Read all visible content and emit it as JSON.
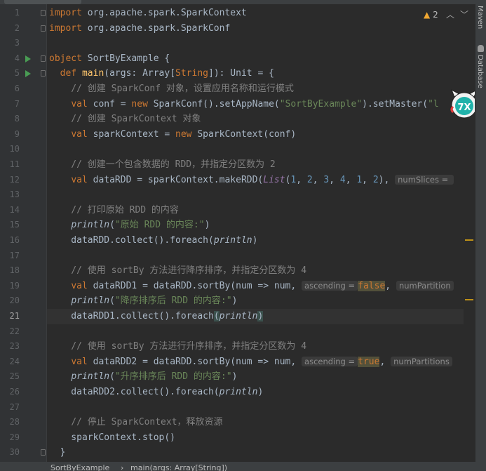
{
  "editor": {
    "warning_count": "2",
    "lines": [
      {
        "n": "1",
        "tokens": [
          [
            "kw",
            "import "
          ],
          [
            "",
            "org.apache.spark.SparkContext"
          ]
        ]
      },
      {
        "n": "2",
        "tokens": [
          [
            "kw",
            "import "
          ],
          [
            "",
            "org.apache.spark.SparkConf"
          ]
        ]
      },
      {
        "n": "3",
        "tokens": []
      },
      {
        "n": "4",
        "tokens": [
          [
            "kw",
            "object "
          ],
          [
            "",
            "SortByExample {"
          ]
        ]
      },
      {
        "n": "5",
        "tokens": [
          [
            "",
            "  "
          ],
          [
            "kw",
            "def "
          ],
          [
            "fn",
            "main"
          ],
          [
            "",
            "(args: Array["
          ],
          [
            "kw",
            "String"
          ],
          [
            "",
            "]): Unit = {"
          ]
        ]
      },
      {
        "n": "6",
        "tokens": [
          [
            "cm",
            "    // 创建 SparkConf 对象，设置应用名称和运行模式"
          ]
        ]
      },
      {
        "n": "7",
        "tokens": [
          [
            "",
            "    "
          ],
          [
            "kw",
            "val "
          ],
          [
            "",
            "conf = "
          ],
          [
            "kw",
            "new "
          ],
          [
            "",
            "SparkConf().setAppName("
          ],
          [
            "str",
            "\"SortByExample\""
          ],
          [
            "",
            ").setMaster("
          ],
          [
            "str",
            "\"l"
          ]
        ]
      },
      {
        "n": "8",
        "tokens": [
          [
            "cm",
            "    // 创建 SparkContext 对象"
          ]
        ]
      },
      {
        "n": "9",
        "tokens": [
          [
            "",
            "    "
          ],
          [
            "kw",
            "val "
          ],
          [
            "",
            "sparkContext = "
          ],
          [
            "kw",
            "new "
          ],
          [
            "",
            "SparkContext(conf)"
          ]
        ]
      },
      {
        "n": "10",
        "tokens": []
      },
      {
        "n": "11",
        "tokens": [
          [
            "cm",
            "    // 创建一个包含数据的 RDD，并指定分区数为 2"
          ]
        ]
      },
      {
        "n": "12",
        "tokens": [
          [
            "",
            "    "
          ],
          [
            "kw",
            "val "
          ],
          [
            "",
            "dataRDD = sparkContext.makeRDD("
          ],
          [
            "pur",
            "List"
          ],
          [
            "",
            "("
          ],
          [
            "num",
            "1"
          ],
          [
            "",
            ", "
          ],
          [
            "num",
            "2"
          ],
          [
            "",
            ", "
          ],
          [
            "num",
            "3"
          ],
          [
            "",
            ", "
          ],
          [
            "num",
            "4"
          ],
          [
            "",
            ", "
          ],
          [
            "num",
            "1"
          ],
          [
            "",
            ", "
          ],
          [
            "num",
            "2"
          ],
          [
            "",
            "), "
          ],
          [
            "hint",
            "numSlices = "
          ]
        ]
      },
      {
        "n": "13",
        "tokens": []
      },
      {
        "n": "14",
        "tokens": [
          [
            "cm",
            "    // 打印原始 RDD 的内容"
          ]
        ]
      },
      {
        "n": "15",
        "tokens": [
          [
            "",
            "    "
          ],
          [
            "it",
            "println"
          ],
          [
            "",
            "("
          ],
          [
            "str",
            "\"原始 RDD 的内容:\""
          ],
          [
            "",
            ")"
          ]
        ]
      },
      {
        "n": "16",
        "tokens": [
          [
            "",
            "    dataRDD.collect().foreach("
          ],
          [
            "it",
            "println"
          ],
          [
            "",
            ")"
          ]
        ]
      },
      {
        "n": "17",
        "tokens": []
      },
      {
        "n": "18",
        "tokens": [
          [
            "cm",
            "    // 使用 sortBy 方法进行降序排序，并指定分区数为 4"
          ]
        ]
      },
      {
        "n": "19",
        "tokens": [
          [
            "",
            "    "
          ],
          [
            "kw",
            "val "
          ],
          [
            "",
            "dataRDD1 = dataRDD.sortBy(num => num, "
          ],
          [
            "hint",
            "ascending ="
          ],
          [
            "",
            ""
          ],
          [
            "hlkw",
            "false"
          ],
          [
            "",
            ", "
          ],
          [
            "hint",
            "numPartition"
          ]
        ]
      },
      {
        "n": "20",
        "tokens": [
          [
            "",
            "    "
          ],
          [
            "it",
            "println"
          ],
          [
            "",
            "("
          ],
          [
            "str",
            "\"降序排序后 RDD 的内容:\""
          ],
          [
            "",
            ")"
          ]
        ]
      },
      {
        "n": "21",
        "tokens": [
          [
            "",
            "    dataRDD1.collect().foreach"
          ],
          [
            "brace",
            "("
          ],
          [
            "it",
            "println"
          ],
          [
            "brace",
            ")"
          ]
        ]
      },
      {
        "n": "22",
        "tokens": []
      },
      {
        "n": "23",
        "tokens": [
          [
            "cm",
            "    // 使用 sortBy 方法进行升序排序，并指定分区数为 4"
          ]
        ]
      },
      {
        "n": "24",
        "tokens": [
          [
            "",
            "    "
          ],
          [
            "kw",
            "val "
          ],
          [
            "",
            "dataRDD2 = dataRDD.sortBy(num => num, "
          ],
          [
            "hint",
            "ascending ="
          ],
          [
            "",
            ""
          ],
          [
            "hlkw",
            "true"
          ],
          [
            "",
            ", "
          ],
          [
            "hint",
            "numPartitions"
          ]
        ]
      },
      {
        "n": "25",
        "tokens": [
          [
            "",
            "    "
          ],
          [
            "it",
            "println"
          ],
          [
            "",
            "("
          ],
          [
            "str",
            "\"升序排序后 RDD 的内容:\""
          ],
          [
            "",
            ")"
          ]
        ]
      },
      {
        "n": "26",
        "tokens": [
          [
            "",
            "    dataRDD2.collect().foreach("
          ],
          [
            "it",
            "println"
          ],
          [
            "",
            ")"
          ]
        ]
      },
      {
        "n": "27",
        "tokens": []
      },
      {
        "n": "28",
        "tokens": [
          [
            "cm",
            "    // 停止 SparkContext，释放资源"
          ]
        ]
      },
      {
        "n": "29",
        "tokens": [
          [
            "",
            "    sparkContext.stop()"
          ]
        ]
      },
      {
        "n": "30",
        "tokens": [
          [
            "",
            "  }"
          ]
        ]
      }
    ]
  },
  "side_tools": {
    "maven": "Maven",
    "database": "Database"
  },
  "breadcrumb": {
    "object": "SortByExample",
    "sep": "›",
    "method": "main(args: Array[String])"
  },
  "colors": {
    "keyword": "#cc7832",
    "string": "#6a8759",
    "comment": "#808080",
    "number": "#6897bb",
    "function": "#ffc66d",
    "background": "#2b2b2b"
  },
  "icons": {
    "run": "run-gutter-icon",
    "warning": "warning-icon",
    "mascot": "plugin-mascot-icon"
  }
}
